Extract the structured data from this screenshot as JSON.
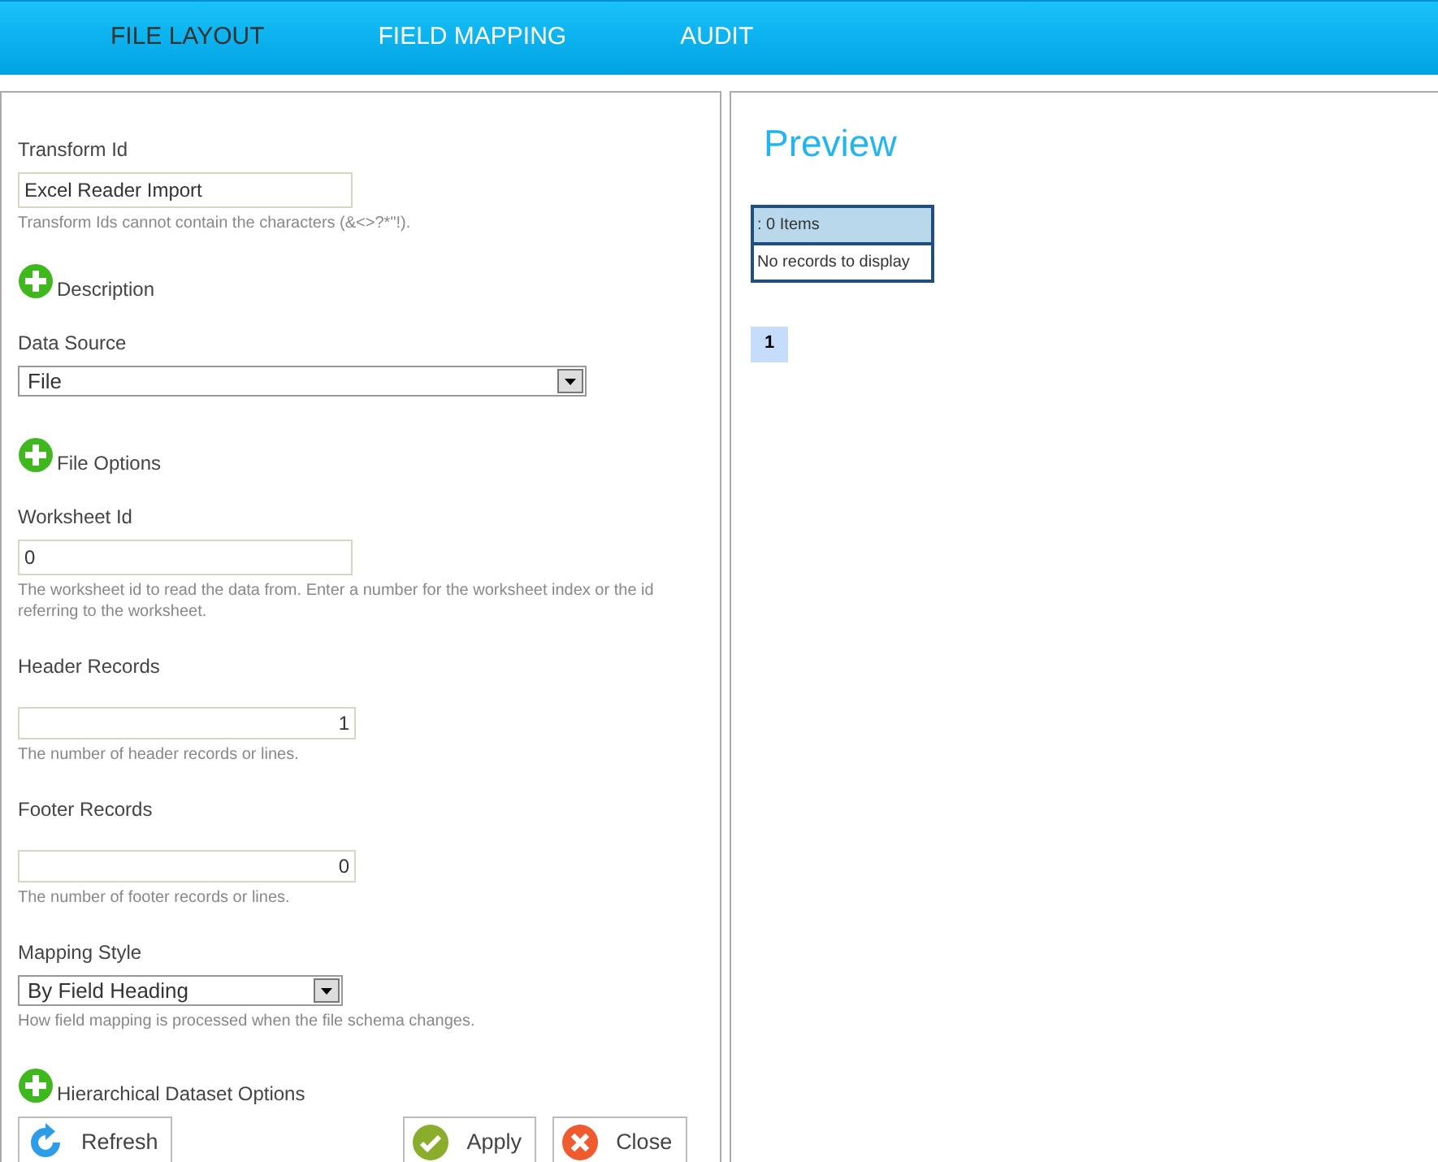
{
  "tabs": [
    {
      "label": "FILE LAYOUT",
      "selected": true
    },
    {
      "label": "FIELD MAPPING",
      "selected": false
    },
    {
      "label": "AUDIT",
      "selected": false
    }
  ],
  "form": {
    "items": [
      {
        "kind": "text",
        "label": "Transform Id",
        "value": "Excel Reader Import",
        "hint": "Transform Ids cannot contain the characters (&<>?*\"!)."
      },
      {
        "kind": "expander",
        "label": "Description"
      },
      {
        "kind": "select",
        "label": "Data Source",
        "value": "File"
      },
      {
        "kind": "expander",
        "label": "File Options"
      },
      {
        "kind": "text",
        "label": "Worksheet Id",
        "value": "0",
        "hint": "The worksheet id to read the data from. Enter a number for the worksheet index or the id referring to the worksheet."
      },
      {
        "kind": "number",
        "label": "Header Records",
        "value": "1",
        "hint": "The number of header records or lines."
      },
      {
        "kind": "number",
        "label": "Footer Records",
        "value": "0",
        "hint": "The number of footer records or lines."
      },
      {
        "kind": "select",
        "label": "Mapping Style",
        "value": "By Field Heading",
        "hint": "How field mapping is processed when the file schema changes."
      },
      {
        "kind": "expander",
        "label": "Hierarchical Dataset Options"
      }
    ],
    "buttons": [
      {
        "kind": "refresh",
        "label": "Refresh"
      },
      {
        "kind": "apply",
        "label": "Apply"
      },
      {
        "kind": "close",
        "label": "Close"
      }
    ]
  },
  "preview": {
    "title": "Preview",
    "grid_header": ": 0 Items",
    "grid_empty": "No records to display",
    "pages": [
      {
        "label": "1",
        "selected": true
      }
    ]
  }
}
